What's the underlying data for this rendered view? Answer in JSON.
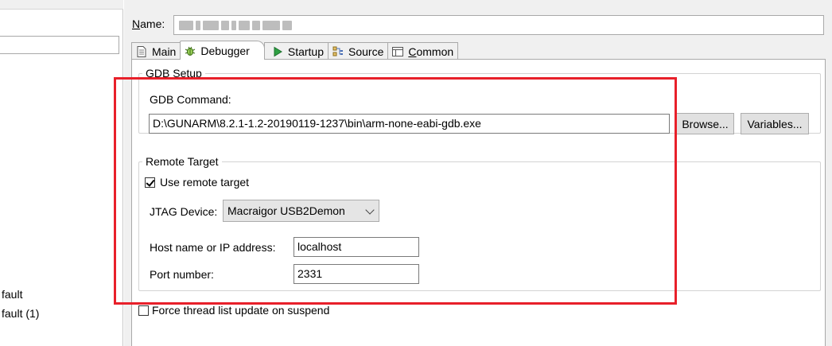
{
  "left_pane": {
    "items": [
      {
        "label": "fault"
      },
      {
        "label": "fault (1)"
      }
    ]
  },
  "name": {
    "label_prefix": "N",
    "label_rest": "ame:"
  },
  "tabs": [
    {
      "label": "Main",
      "icon": "document-icon"
    },
    {
      "label": "Debugger",
      "icon": "bug-icon",
      "active": true
    },
    {
      "label": "Startup",
      "icon": "play-icon"
    },
    {
      "label": "Source",
      "icon": "source-icon"
    },
    {
      "label_prefix": "C",
      "label_rest": "ommon",
      "icon": "table-icon"
    }
  ],
  "gdb_setup": {
    "title": "GDB Setup",
    "command_label": "GDB Command:",
    "command_value": "D:\\GUNARM\\8.2.1-1.2-20190119-1237\\bin\\arm-none-eabi-gdb.exe",
    "browse_label": "Browse...",
    "variables_label": "Variables..."
  },
  "remote_target": {
    "title": "Remote Target",
    "use_remote_label": "Use remote target",
    "use_remote_checked": true,
    "jtag_label": "JTAG Device:",
    "jtag_value": "Macraigor USB2Demon",
    "host_label": "Host name or IP address:",
    "host_value": "localhost",
    "port_label": "Port number:",
    "port_value": "2331"
  },
  "force_thread": {
    "label": "Force thread list update on suspend",
    "checked": false
  },
  "colors": {
    "highlight": "#e8202a",
    "tab_active_bg": "#ffffff",
    "panel_bg": "#f0f0f0"
  }
}
